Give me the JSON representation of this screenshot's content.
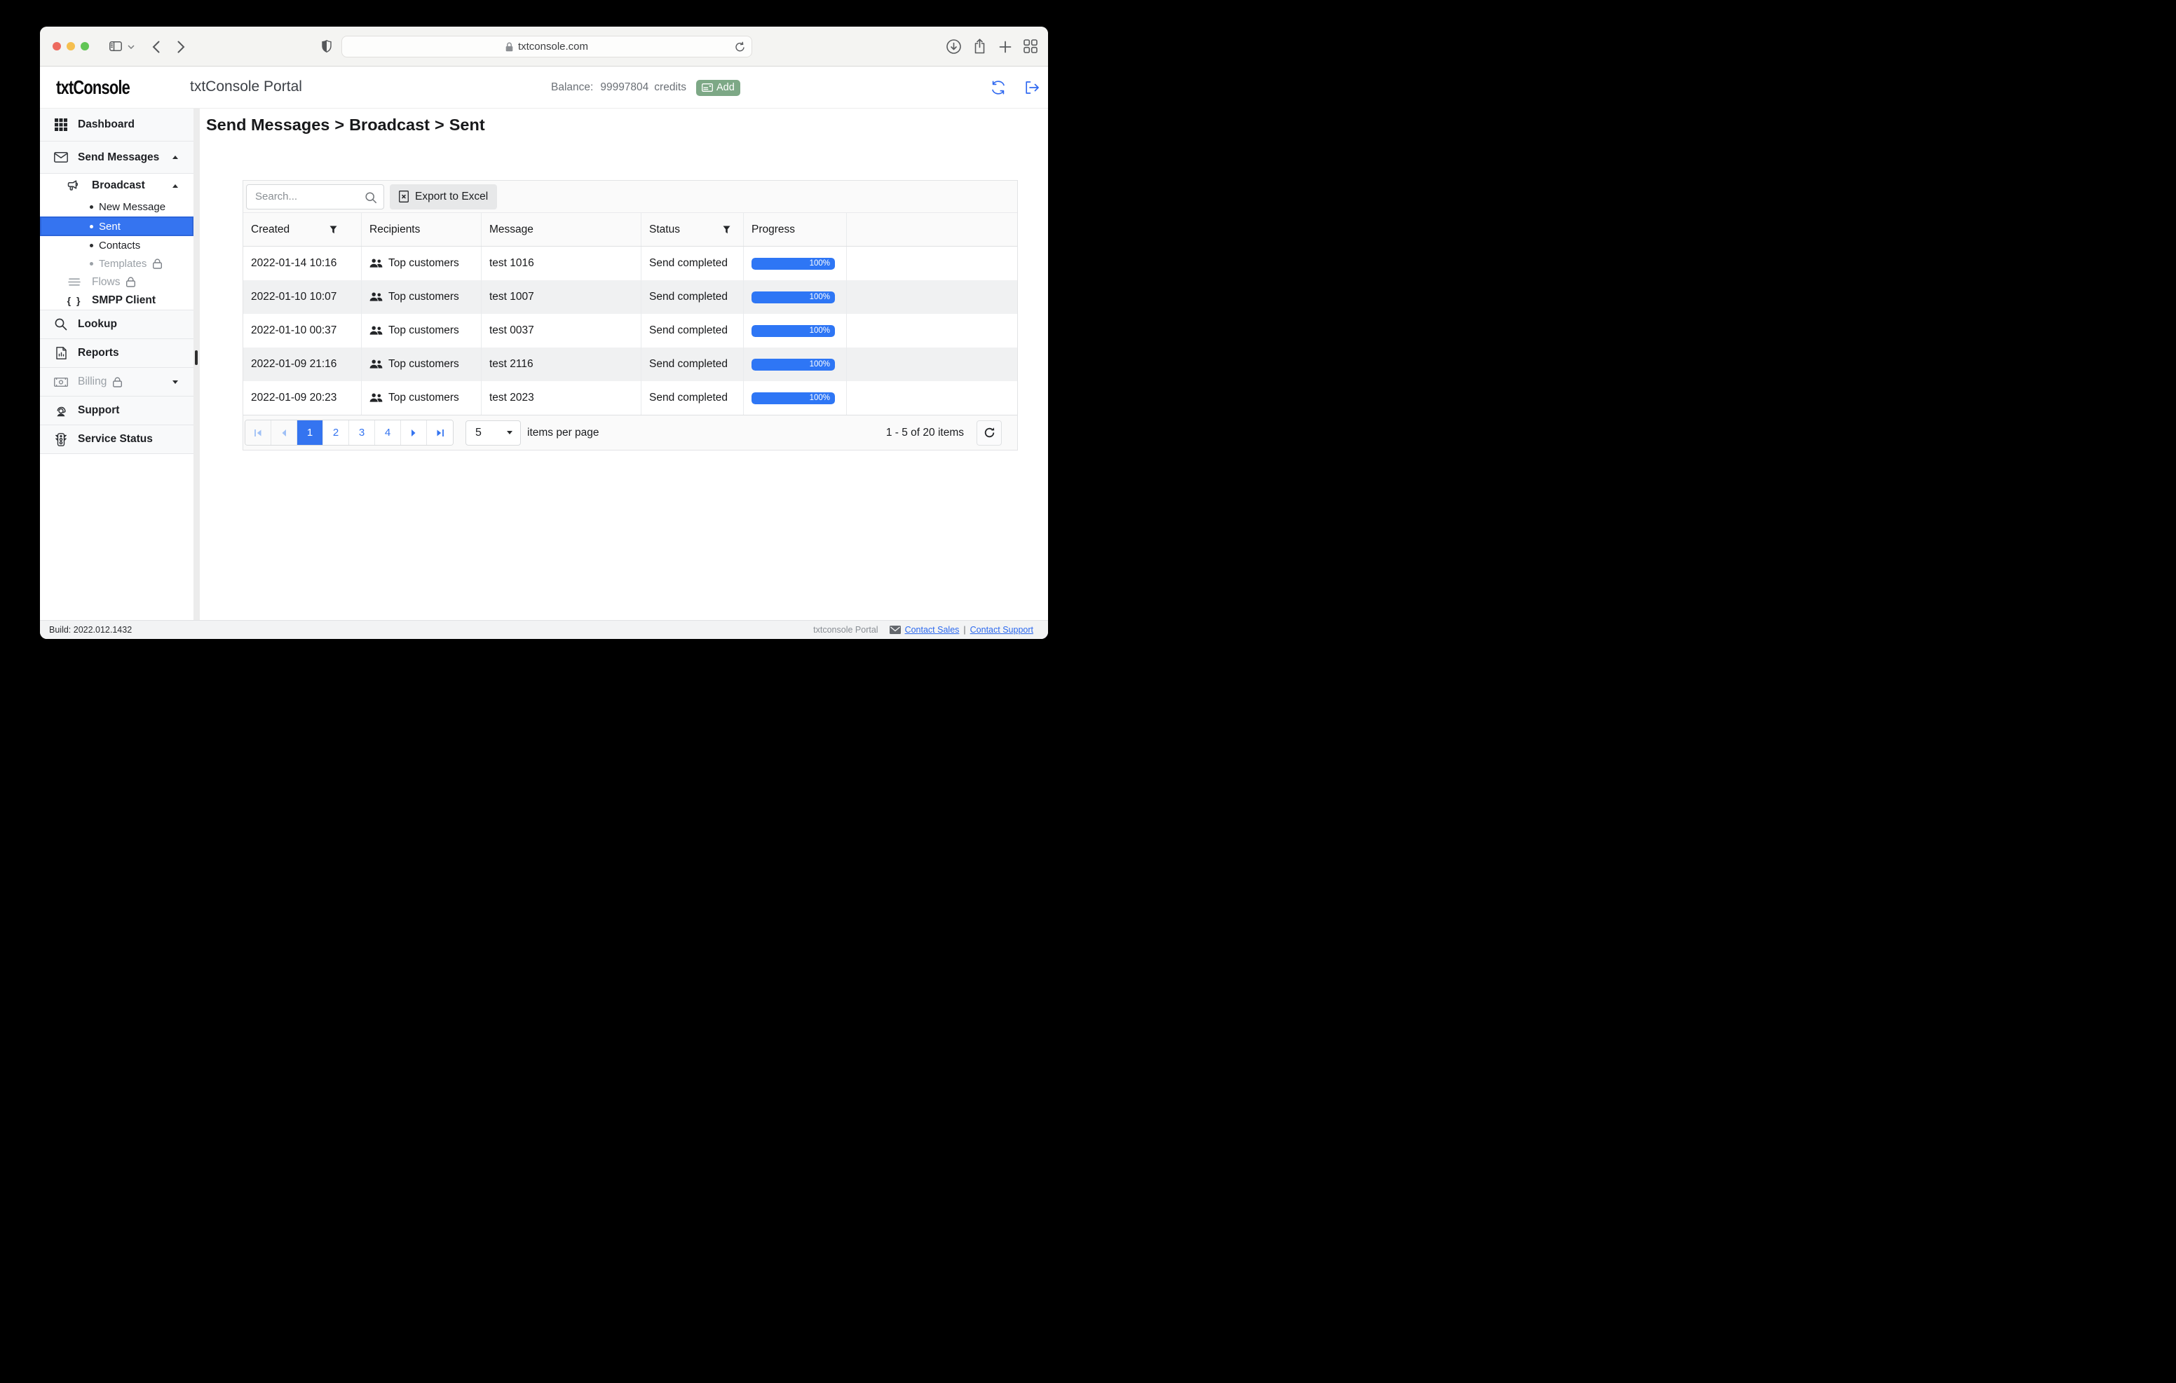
{
  "browser": {
    "url": "txtconsole.com"
  },
  "header": {
    "logo": "txtConsole",
    "title": "txtConsole Portal",
    "balance_label": "Balance:",
    "balance_value": "99997804",
    "balance_unit": "credits",
    "add_label": "Add"
  },
  "sidebar": {
    "items": [
      {
        "label": "Dashboard",
        "icon": "grid-icon"
      },
      {
        "label": "Send Messages",
        "icon": "envelope-icon",
        "expanded": true
      },
      {
        "label": "Broadcast",
        "icon": "megaphone-icon",
        "expanded": true
      },
      {
        "label": "New Message"
      },
      {
        "label": "Sent",
        "selected": true
      },
      {
        "label": "Contacts"
      },
      {
        "label": "Templates",
        "locked": true
      },
      {
        "label": "Flows",
        "icon": "lines-icon",
        "locked": true
      },
      {
        "label": "SMPP Client",
        "icon": "braces-icon"
      },
      {
        "label": "Lookup",
        "icon": "magnifier-icon"
      },
      {
        "label": "Reports",
        "icon": "report-icon"
      },
      {
        "label": "Billing",
        "icon": "banknote-icon",
        "locked": true,
        "collapsed": true
      },
      {
        "label": "Support",
        "icon": "support-icon"
      },
      {
        "label": "Service Status",
        "icon": "traffic-light-icon"
      }
    ]
  },
  "content": {
    "breadcrumb": {
      "parts": [
        "Send Messages",
        "Broadcast",
        "Sent"
      ],
      "separator": ">"
    },
    "toolbar": {
      "search_placeholder": "Search...",
      "export_label": "Export to Excel"
    },
    "table": {
      "columns": [
        "Created",
        "Recipients",
        "Message",
        "Status",
        "Progress"
      ],
      "filter_columns": [
        "Created",
        "Status"
      ],
      "rows": [
        {
          "created": "2022-01-14 10:16",
          "recipients": "Top customers",
          "message": "test 1016",
          "status": "Send completed",
          "progress": "100%"
        },
        {
          "created": "2022-01-10 10:07",
          "recipients": "Top customers",
          "message": "test 1007",
          "status": "Send completed",
          "progress": "100%"
        },
        {
          "created": "2022-01-10 00:37",
          "recipients": "Top customers",
          "message": "test 0037",
          "status": "Send completed",
          "progress": "100%"
        },
        {
          "created": "2022-01-09 21:16",
          "recipients": "Top customers",
          "message": "test 2116",
          "status": "Send completed",
          "progress": "100%"
        },
        {
          "created": "2022-01-09 20:23",
          "recipients": "Top customers",
          "message": "test 2023",
          "status": "Send completed",
          "progress": "100%"
        }
      ]
    },
    "pagination": {
      "pages": [
        "1",
        "2",
        "3",
        "4"
      ],
      "active_page": "1",
      "page_size": "5",
      "items_per_page_label": "items per page",
      "range_label": "1 - 5 of 20 items"
    }
  },
  "footer": {
    "build": "Build: 2022.012.1432",
    "portal_name": "txtconsole Portal",
    "contact_sales": "Contact Sales",
    "separator": "|",
    "contact_support": "Contact Support"
  },
  "colors": {
    "accent_blue": "#3474f0",
    "selected_border_blue": "#2d65da",
    "progress_blue": "#2e76f5",
    "link_blue": "#2c69ee",
    "add_green": "#7da886",
    "traffic_red": "#ed6a5f",
    "traffic_yellow": "#f5bf4f",
    "traffic_green": "#61c555"
  }
}
